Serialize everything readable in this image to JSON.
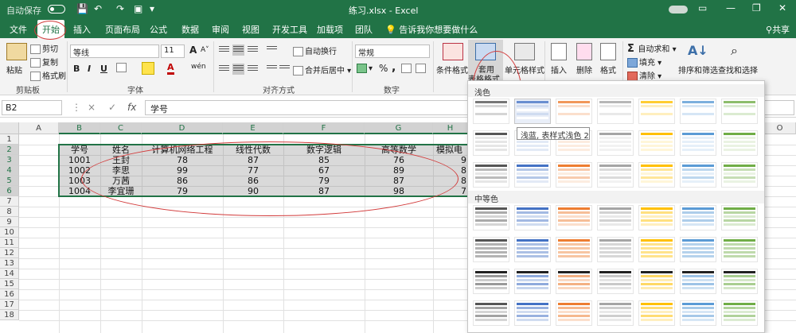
{
  "titlebar": {
    "autosave_label": "自动保存",
    "autosave_state": "关",
    "title": "练习.xlsx - Excel"
  },
  "tabs": [
    "文件",
    "开始",
    "插入",
    "页面布局",
    "公式",
    "数据",
    "审阅",
    "视图",
    "开发工具",
    "加载项",
    "团队"
  ],
  "tellme": "告诉我你想要做什么",
  "share": "共享",
  "ribbon": {
    "clipboard": {
      "paste": "粘贴",
      "cut": "剪切",
      "copy": "复制",
      "painter": "格式刷",
      "label": "剪贴板"
    },
    "font": {
      "name": "等线",
      "size": "11",
      "label": "字体",
      "bold": "B",
      "italic": "I",
      "underline": "U",
      "grow": "A",
      "wen": "wén",
      "font_color": "A"
    },
    "alignment": {
      "wrap": "自动换行",
      "merge": "合并后居中",
      "label": "对齐方式"
    },
    "number": {
      "format": "常规",
      "percent": "%",
      "comma": ",",
      "label": "数字"
    },
    "styles": {
      "conditional": "条件格式",
      "table_line1": "套用",
      "table_line2": "表格格式",
      "cell": "单元格样式"
    },
    "cells": {
      "insert": "插入",
      "delete": "删除",
      "format": "格式"
    },
    "editing": {
      "autosum": "自动求和",
      "fill": "填充",
      "clear": "清除",
      "sort": "排序和筛选",
      "find": "查找和选择"
    }
  },
  "formulabar": {
    "namebox": "B2",
    "cancel": "×",
    "enter": "✓",
    "fx": "fx",
    "content": "学号"
  },
  "columns": [
    "A",
    "B",
    "C",
    "D",
    "E",
    "F",
    "G",
    "H",
    "O"
  ],
  "rows": [
    "1",
    "2",
    "3",
    "4",
    "5",
    "6",
    "7",
    "8",
    "9",
    "10",
    "11",
    "12",
    "13",
    "14",
    "15",
    "16",
    "17",
    "18"
  ],
  "table": {
    "headers": [
      "学号",
      "姓名",
      "计算机网络工程",
      "线性代数",
      "数字逻辑",
      "高等数学",
      "模拟电"
    ],
    "rows": [
      [
        "1001",
        "王封",
        "78",
        "87",
        "85",
        "76",
        "9"
      ],
      [
        "1002",
        "李思",
        "99",
        "77",
        "67",
        "89",
        "8"
      ],
      [
        "1003",
        "万茜",
        "86",
        "86",
        "79",
        "87",
        "8"
      ],
      [
        "1004",
        "李宜珊",
        "79",
        "90",
        "87",
        "98",
        "7"
      ]
    ]
  },
  "gallery": {
    "light_label": "浅色",
    "medium_label": "中等色",
    "tooltip": "浅蓝, 表样式浅色 2",
    "palette": [
      "#555555",
      "#4472c4",
      "#ed7d31",
      "#a5a5a5",
      "#ffc000",
      "#5b9bd5",
      "#70ad47"
    ]
  }
}
